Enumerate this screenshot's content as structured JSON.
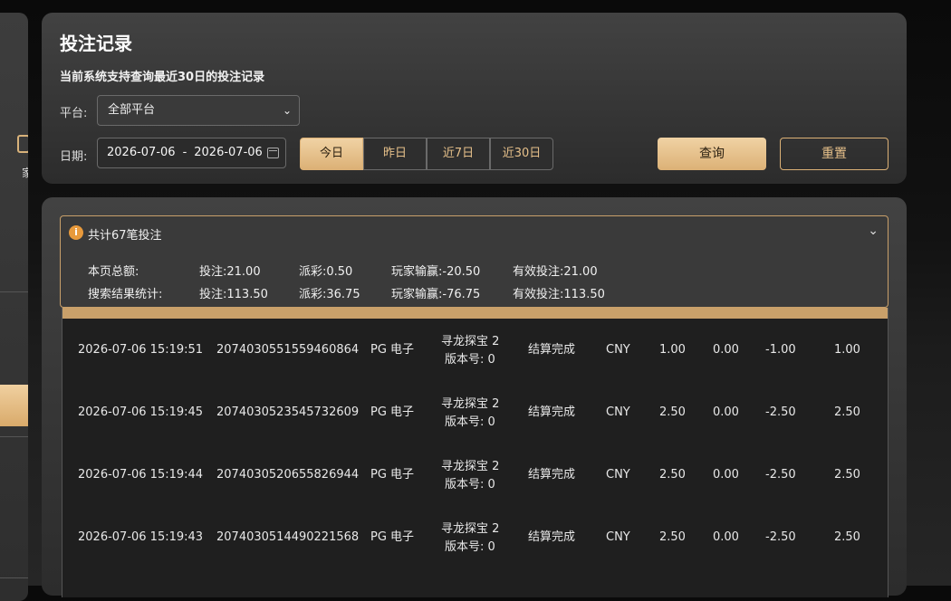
{
  "left_panel": {
    "label": "家"
  },
  "header": {
    "title": "投注记录",
    "subtitle": "当前系统支持查询最近30日的投注记录"
  },
  "filters": {
    "platform_label": "平台:",
    "platform_value": "全部平台",
    "date_label": "日期:",
    "date_from": "2026-07-06",
    "date_sep": "-",
    "date_to": "2026-07-06",
    "ranges": [
      "今日",
      "昨日",
      "近7日",
      "近30日"
    ],
    "active_range": "今日",
    "query_label": "查询",
    "reset_label": "重置"
  },
  "summary": {
    "count_text": "共计67笔投注",
    "page_total": {
      "label": "本页总额:",
      "bet": "投注:21.00",
      "payout": "派彩:0.50",
      "winloss": "玩家输赢:-20.50",
      "valid": "有效投注:21.00"
    },
    "search_total": {
      "label": "搜索结果统计:",
      "bet": "投注:113.50",
      "payout": "派彩:36.75",
      "winloss": "玩家输赢:-76.75",
      "valid": "有效投注:113.50"
    }
  },
  "rows": [
    {
      "time": "2026-07-06 15:19:51",
      "order": "2074030551559460864",
      "platform": "PG 电子",
      "game": "寻龙探宝 2",
      "version": "版本号: 0",
      "status": "结算完成",
      "currency": "CNY",
      "bet": "1.00",
      "payout": "0.00",
      "winloss": "-1.00",
      "valid": "1.00"
    },
    {
      "time": "2026-07-06 15:19:45",
      "order": "2074030523545732609",
      "platform": "PG 电子",
      "game": "寻龙探宝 2",
      "version": "版本号: 0",
      "status": "结算完成",
      "currency": "CNY",
      "bet": "2.50",
      "payout": "0.00",
      "winloss": "-2.50",
      "valid": "2.50"
    },
    {
      "time": "2026-07-06 15:19:44",
      "order": "2074030520655826944",
      "platform": "PG 电子",
      "game": "寻龙探宝 2",
      "version": "版本号: 0",
      "status": "结算完成",
      "currency": "CNY",
      "bet": "2.50",
      "payout": "0.00",
      "winloss": "-2.50",
      "valid": "2.50"
    },
    {
      "time": "2026-07-06 15:19:43",
      "order": "2074030514490221568",
      "platform": "PG 电子",
      "game": "寻龙探宝 2",
      "version": "版本号: 0",
      "status": "结算完成",
      "currency": "CNY",
      "bet": "2.50",
      "payout": "0.00",
      "winloss": "-2.50",
      "valid": "2.50"
    }
  ]
}
